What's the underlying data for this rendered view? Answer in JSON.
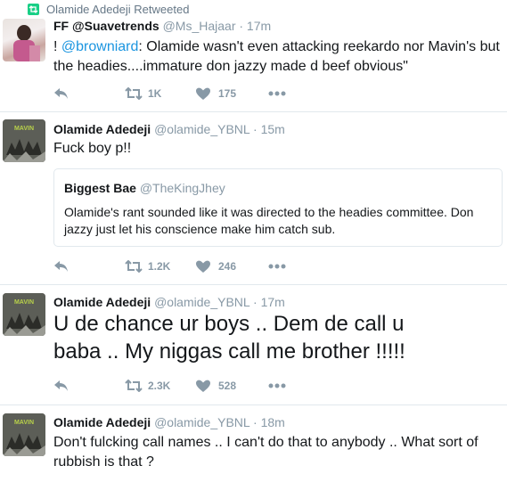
{
  "retweet_banner": {
    "label": "Olamide Adedeji Retweeted",
    "icon": "retweet-icon"
  },
  "tweets": [
    {
      "name": "FF @Suavetrends",
      "handle": "@Ms_Hajaar",
      "time": "· 17m",
      "text_line1_prefix": "! ",
      "text_line1_mention": "@browniard",
      "text_line1_suffix": ": Olamide wasn't even attacking reekardo nor Mavin's but",
      "text_line2": "the headies....immature don jazzy made d beef obvious\"",
      "retweets": "1K",
      "likes": "175"
    },
    {
      "name": "Olamide Adedeji",
      "handle": "@olamide_YBNL",
      "time": "· 15m",
      "text": "Fuck boy p!!",
      "quote": {
        "name": "Biggest Bae",
        "handle": "@TheKingJhey",
        "text_line1": "Olamide's rant sounded like it was directed to the headies committee. Don",
        "text_line2": "jazzy just let his conscience make him catch sub."
      },
      "retweets": "1.2K",
      "likes": "246"
    },
    {
      "name": "Olamide Adedeji",
      "handle": "@olamide_YBNL",
      "time": "· 17m",
      "text_line1": "U de chance ur boys .. Dem de call u",
      "text_line2": "baba .. My niggas call me brother !!!!!",
      "retweets": "2.3K",
      "likes": "528"
    },
    {
      "name": "Olamide Adedeji",
      "handle": "@olamide_YBNL",
      "time": "· 18m",
      "text_line1": "Don't fulcking call names .. I can't do that to anybody .. What sort of",
      "text_line2": "rubbish is that ?"
    }
  ],
  "colors": {
    "mention": "#1b95e0",
    "muted": "#8899a6",
    "retweet_green": "#19cf86",
    "border": "#e1e8ed"
  }
}
